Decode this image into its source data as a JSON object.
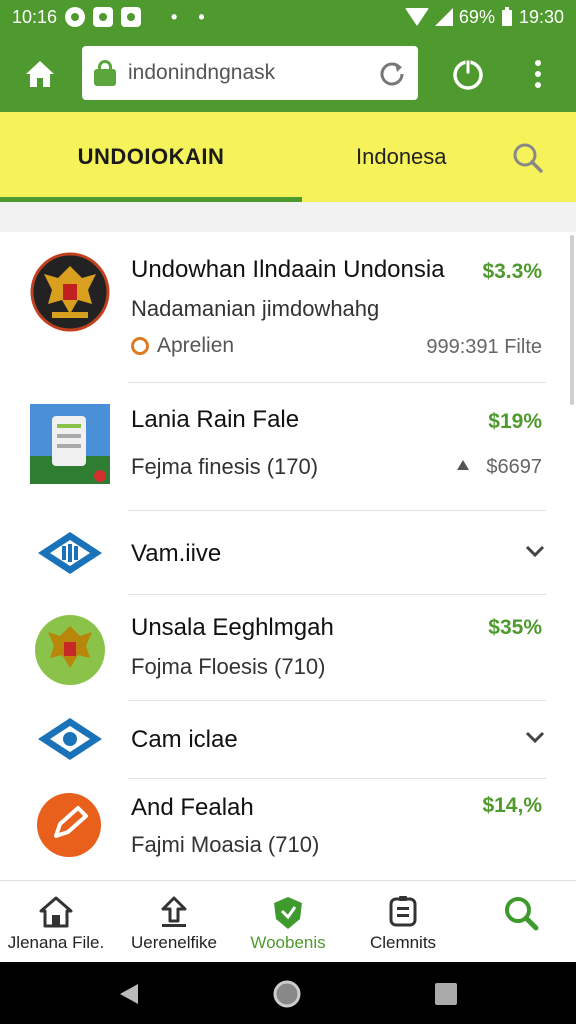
{
  "status": {
    "time_left": "10:16",
    "battery": "69%",
    "time_right": "19:30"
  },
  "browser": {
    "url": "indonindngnask"
  },
  "tabs": [
    {
      "label": "UNDOIOKAIN",
      "active": true
    },
    {
      "label": "Indonesa",
      "active": false
    }
  ],
  "list": {
    "items": [
      {
        "title": "Undowhan Ilndaain Undonsia",
        "subtitle": "Nadamanian jimdowhahg",
        "meta": "Aprelien",
        "percent": "$3.3%",
        "right_meta": "999:391 Filte"
      },
      {
        "title": "Lania Rain Fale",
        "subtitle": "Fejma finesis (170)",
        "percent": "$19%",
        "right_meta": "$6697"
      },
      {
        "title": "Vam.iive"
      },
      {
        "title": "Unsala Eeghlmgah",
        "subtitle": "Fojma Floesis (710)",
        "percent": "$35%"
      },
      {
        "title": "Cam iclae"
      },
      {
        "title": "And Fealah",
        "subtitle": "Fajmi Moasia (710)",
        "percent": "$14,%"
      }
    ]
  },
  "bottom_nav": [
    {
      "label": "Jlenana File.",
      "icon": "home-icon"
    },
    {
      "label": "Uerenelfike",
      "icon": "upload-icon"
    },
    {
      "label": "Woobenis",
      "icon": "shield-icon",
      "active": true
    },
    {
      "label": "Clemnits",
      "icon": "document-icon"
    },
    {
      "label": "",
      "icon": "search-icon"
    }
  ],
  "colors": {
    "brand_green": "#4e9a2e",
    "tab_yellow": "#f6f35a"
  }
}
